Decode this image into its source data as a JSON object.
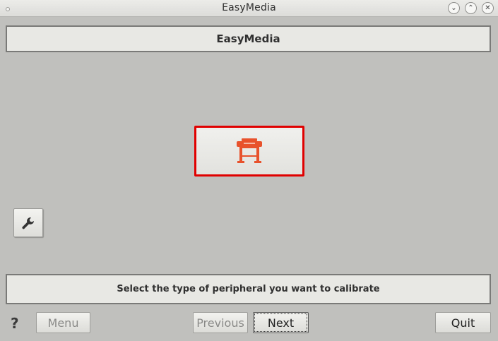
{
  "window": {
    "title": "EasyMedia",
    "controls": {
      "minimize": "⌄",
      "maximize": "⌃",
      "close": "✕"
    }
  },
  "header": {
    "title": "EasyMedia"
  },
  "main": {
    "printer_button_icon": "printer-icon",
    "tools_button_icon": "wrench-icon"
  },
  "status": {
    "text": "Select the type of peripheral you want to calibrate"
  },
  "footer": {
    "help_label": "?",
    "menu_label": "Menu",
    "previous_label": "Previous",
    "next_label": "Next",
    "quit_label": "Quit"
  },
  "colors": {
    "accent_printer": "#e8522c",
    "selection_border": "#e00000",
    "background": "#c0c0bd"
  }
}
